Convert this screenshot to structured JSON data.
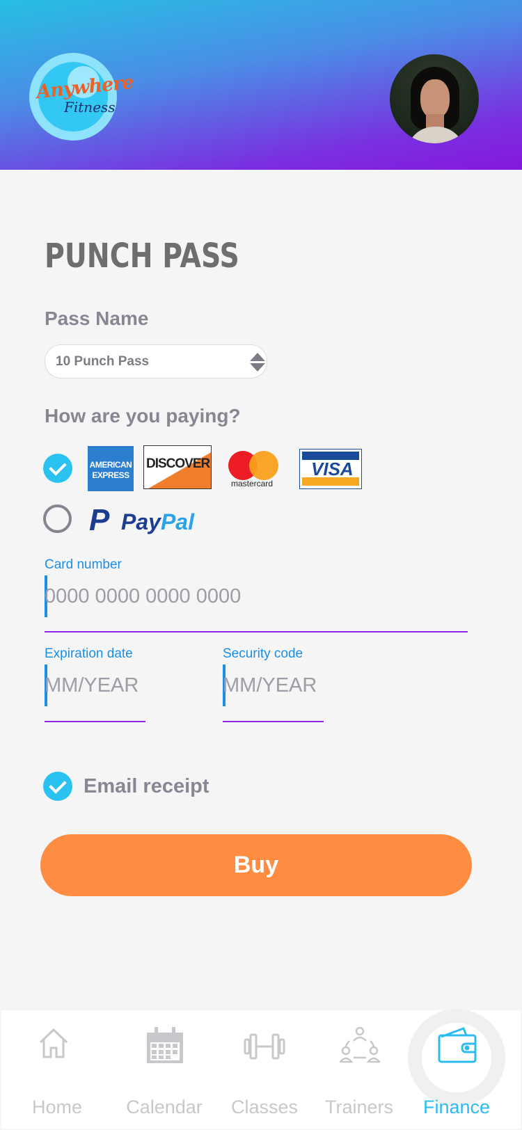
{
  "header": {
    "logo_line1": "Anywhere",
    "logo_line2": "Fitness",
    "gradient": [
      "#26bfe3",
      "#8518dc"
    ]
  },
  "page": {
    "title": "PUNCH PASS",
    "pass_name_label": "Pass Name",
    "pass_select_value": "10 Punch Pass",
    "paying_label": "How are you paying?"
  },
  "payment": {
    "cards_selected": true,
    "paypal_selected": false,
    "amex_line1": "AMERICAN",
    "amex_line2": "EXPRESS",
    "discover": "DISCOVER",
    "mastercard": "mastercard",
    "visa": "VISA",
    "paypal_a": "Pay",
    "paypal_b": "Pal"
  },
  "form": {
    "card_number_label": "Card number",
    "card_number_placeholder": "0000 0000 0000 0000",
    "expiration_label": "Expiration date",
    "expiration_placeholder": "MM/YEAR",
    "security_label": "Security code",
    "security_placeholder": "MM/YEAR"
  },
  "email_receipt": {
    "label": "Email receipt",
    "checked": true
  },
  "buy_label": "Buy",
  "colors": {
    "accent": "#2ac2f0",
    "buy": "#fe8d42",
    "field_line": "#8e22e0",
    "field_label": "#1b8ee8"
  },
  "nav": {
    "items": [
      {
        "label": "Home",
        "icon": "home-icon"
      },
      {
        "label": "Calendar",
        "icon": "calendar-icon"
      },
      {
        "label": "Classes",
        "icon": "dumbbell-icon"
      },
      {
        "label": "Trainers",
        "icon": "trainers-icon"
      },
      {
        "label": "Finance",
        "icon": "wallet-icon",
        "active": true
      }
    ]
  }
}
